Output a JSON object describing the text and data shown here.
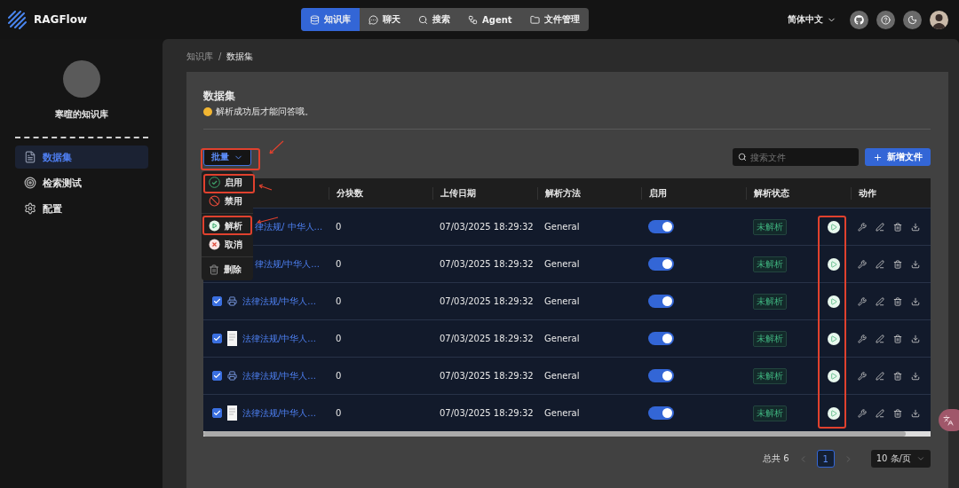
{
  "app": {
    "name": "RAGFlow"
  },
  "nav": [
    {
      "label": "知识库",
      "selected": true
    },
    {
      "label": "聊天",
      "selected": false
    },
    {
      "label": "搜索",
      "selected": false
    },
    {
      "label": "Agent",
      "selected": false
    },
    {
      "label": "文件管理",
      "selected": false
    }
  ],
  "language": "简体中文",
  "knowledge_base": {
    "name": "寒暄的知识库"
  },
  "sidebar": {
    "items": [
      {
        "label": "数据集",
        "selected": true
      },
      {
        "label": "检索测试",
        "selected": false
      },
      {
        "label": "配置",
        "selected": false
      }
    ]
  },
  "breadcrumb": {
    "separator": "/",
    "items": [
      {
        "label": "知识库",
        "selected": false
      },
      {
        "label": "数据集",
        "selected": true
      }
    ]
  },
  "page": {
    "title": "数据集",
    "subtitle": "解析成功后才能问答哦。"
  },
  "bulk_button": "批量",
  "bulk_menu": [
    {
      "label": "启用",
      "kind": "enable",
      "divider_before": false
    },
    {
      "label": "禁用",
      "kind": "disable",
      "divider_before": false
    },
    {
      "label": "解析",
      "kind": "parse",
      "divider_before": true
    },
    {
      "label": "取消",
      "kind": "cancel",
      "divider_before": false
    },
    {
      "label": "删除",
      "kind": "delete",
      "divider_before": true
    }
  ],
  "search": {
    "placeholder": "搜索文件"
  },
  "add_button": "新增文件",
  "table": {
    "columns": [
      "分块数",
      "上传日期",
      "解析方法",
      "启用",
      "解析状态",
      "动作"
    ],
    "rows": [
      {
        "name": "律法规/ 中华人...",
        "chunks": "0",
        "date": "07/03/2025 18:29:32",
        "method": "General",
        "enabled": true,
        "status": "未解析"
      },
      {
        "name": "律法规/中华人...",
        "chunks": "0",
        "date": "07/03/2025 18:29:32",
        "method": "General",
        "enabled": true,
        "status": "未解析"
      },
      {
        "checked": true,
        "name": "法律法规/中华人...",
        "chunks": "0",
        "date": "07/03/2025 18:29:32",
        "method": "General",
        "enabled": true,
        "status": "未解析"
      },
      {
        "checked": true,
        "name": "法律法规/中华人...",
        "chunks": "0",
        "date": "07/03/2025 18:29:32",
        "method": "General",
        "enabled": true,
        "status": "未解析"
      },
      {
        "checked": true,
        "name": "法律法规/中华人...",
        "chunks": "0",
        "date": "07/03/2025 18:29:32",
        "method": "General",
        "enabled": true,
        "status": "未解析"
      },
      {
        "checked": true,
        "name": "法律法规/中华人...",
        "chunks": "0",
        "date": "07/03/2025 18:29:32",
        "method": "General",
        "enabled": true,
        "status": "未解析"
      }
    ]
  },
  "pagination": {
    "total": "总共 6",
    "pages": [
      {
        "label": "1",
        "selected": true
      }
    ],
    "page_size": "10 条/页"
  }
}
